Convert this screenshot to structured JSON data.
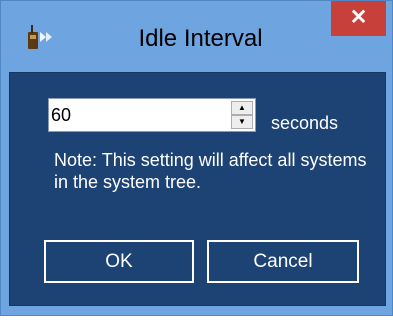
{
  "window": {
    "title": "Idle Interval",
    "close_label": "✕",
    "icon": "handheld-radio-icon"
  },
  "interval": {
    "value": "60",
    "unit_label": "seconds"
  },
  "note": "Note: This setting will affect all systems in the system tree.",
  "buttons": {
    "ok_label": "OK",
    "cancel_label": "Cancel"
  },
  "colors": {
    "frame": "#6ea4df",
    "client_bg": "#1d4274",
    "close_bg": "#c7403a"
  }
}
